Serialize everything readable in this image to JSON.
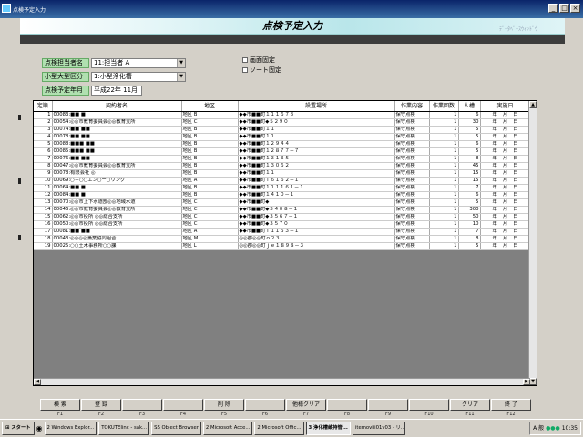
{
  "window": {
    "title": "点検予定入力",
    "banner": "点検予定入力",
    "banner_ghost": "ﾃﾞｰﾀﾍﾞｰｽｳｨﾝﾄﾞｳ"
  },
  "form": {
    "label1": "点検担当者名",
    "value1": "11:担当者 A",
    "label2": "小型大型区分",
    "value2": "1:小型浄化槽",
    "label3": "点検予定年月",
    "value3": "平成22年 11月",
    "check1": "画面固定",
    "check2": "ソート固定"
  },
  "grid": {
    "headers": [
      "定順",
      "契約者名",
      "地区",
      "設置場所",
      "作業内容",
      "作業回数",
      "人槽",
      "実施日"
    ],
    "date_units": [
      "年",
      "月",
      "日"
    ],
    "rows": [
      {
        "no": "1",
        "name": "00083:■■ ■",
        "area": "地区 B",
        "place": "◆◆市■■町１１１６７３",
        "work": "保守点検",
        "count": "1",
        "cap": "6"
      },
      {
        "no": "2",
        "name": "00054:◎◎市教育委員会◎◎教育支所",
        "area": "地区 C",
        "place": "◆◆市■■町◆５２９０",
        "work": "保守点検",
        "count": "1",
        "cap": "30"
      },
      {
        "no": "3",
        "name": "00074:■■ ■■",
        "area": "地区 B",
        "place": "◆◆市■■町１１",
        "work": "保守点検",
        "count": "1",
        "cap": "5"
      },
      {
        "no": "4",
        "name": "00078:■■ ■■",
        "area": "地区 B",
        "place": "◆◆市■■町１１",
        "work": "保守点検",
        "count": "1",
        "cap": "5"
      },
      {
        "no": "5",
        "name": "00088:■■■ ■■",
        "area": "地区 B",
        "place": "◆◆市■■町１２９４４",
        "work": "保守点検",
        "count": "1",
        "cap": "6"
      },
      {
        "no": "6",
        "name": "00085:■■■ ■■",
        "area": "地区 B",
        "place": "◆◆市■■町１２８７７－７",
        "work": "保守点検",
        "count": "1",
        "cap": "5"
      },
      {
        "no": "7",
        "name": "00076:■■ ■■",
        "area": "地区 B",
        "place": "◆◆市■■町１３１８５",
        "work": "保守点検",
        "count": "1",
        "cap": "8"
      },
      {
        "no": "8",
        "name": "00047:◎◎市教育委員会◎◎教育支所",
        "area": "地区 B",
        "place": "◆◆市■■町１３０６２",
        "work": "保守点検",
        "count": "1",
        "cap": "45"
      },
      {
        "no": "9",
        "name": "00078:有限会社 ◎",
        "area": "地区 B",
        "place": "◆◆市■■町１１",
        "work": "保守点検",
        "count": "1",
        "cap": "15"
      },
      {
        "no": "10",
        "name": "00069:○－○○エン○ー○リング",
        "area": "地区 A",
        "place": "◆◆市■■町Ｔ６１６２－１",
        "work": "保守点検",
        "count": "1",
        "cap": "15"
      },
      {
        "no": "11",
        "name": "00064:■■ ■",
        "area": "地区 B",
        "place": "◆◆市■■町１１１１６１－１",
        "work": "保守点検",
        "count": "1",
        "cap": "7"
      },
      {
        "no": "12",
        "name": "00084:■■ ■",
        "area": "地区 B",
        "place": "◆◆市■■町１４１０－１",
        "work": "保守点検",
        "count": "1",
        "cap": "6"
      },
      {
        "no": "13",
        "name": "00070:◎◎市上下水道部◎◎地域水道",
        "area": "地区 C",
        "place": "◆◆市■■町◆",
        "work": "保守点検",
        "count": "1",
        "cap": "5"
      },
      {
        "no": "14",
        "name": "00046:◎◎市教育委員会◎◎教育支所",
        "area": "地区 C",
        "place": "◆◆市■■町◆３４０８－１",
        "work": "保守点検",
        "count": "1",
        "cap": "300"
      },
      {
        "no": "15",
        "name": "00062:◎◎市役所 ◎◎総合支所",
        "area": "地区 C",
        "place": "◆◆市■■町◆３５６７－１",
        "work": "保守点検",
        "count": "1",
        "cap": "50"
      },
      {
        "no": "16",
        "name": "00050:◎◎市役所 ◎◎総合支所",
        "area": "地区 C",
        "place": "◆◆市■■町◆３５７０",
        "work": "保守点検",
        "count": "1",
        "cap": "10"
      },
      {
        "no": "17",
        "name": "00081:■■ ■■",
        "area": "地区 A",
        "place": "◆◆市■■町Ｔ１１５３－１",
        "work": "保守点検",
        "count": "1",
        "cap": "7"
      },
      {
        "no": "18",
        "name": "00043:◎◎◎◎漁業協同組合",
        "area": "地区 M",
        "place": "◎◎郡◎◎町ｏ２３",
        "work": "保守点検",
        "count": "1",
        "cap": "8"
      },
      {
        "no": "19",
        "name": "00025:○○土木事務所○○課",
        "area": "地区 L",
        "place": "◎◎郡◎◎町ｊｅ１８９８－３",
        "work": "保守点検",
        "count": "1",
        "cap": "5"
      }
    ]
  },
  "fkeys": [
    {
      "label": "検 索",
      "key": "F1"
    },
    {
      "label": "登 録",
      "key": "F2"
    },
    {
      "label": "",
      "key": "F3"
    },
    {
      "label": "",
      "key": "F4"
    },
    {
      "label": "削 除",
      "key": "F5"
    },
    {
      "label": "",
      "key": "F6"
    },
    {
      "label": "他様クリア",
      "key": "F7"
    },
    {
      "label": "",
      "key": "F8"
    },
    {
      "label": "",
      "key": "F9"
    },
    {
      "label": "",
      "key": "F10"
    },
    {
      "label": "クリア",
      "key": "F11"
    },
    {
      "label": "終 了",
      "key": "F12"
    }
  ],
  "taskbar": {
    "start": "スタート",
    "items": [
      "2 Windows Explor...",
      "TOKUTEIinc - sak...",
      "SS Object Browser",
      "2 Microsoft Acce...",
      "2 Microsoft Offic...",
      "3 浄化槽維持管...",
      "itemoviii01v03 - リ..."
    ],
    "active_index": 5,
    "ime": "A 般",
    "clock": "10:35"
  }
}
